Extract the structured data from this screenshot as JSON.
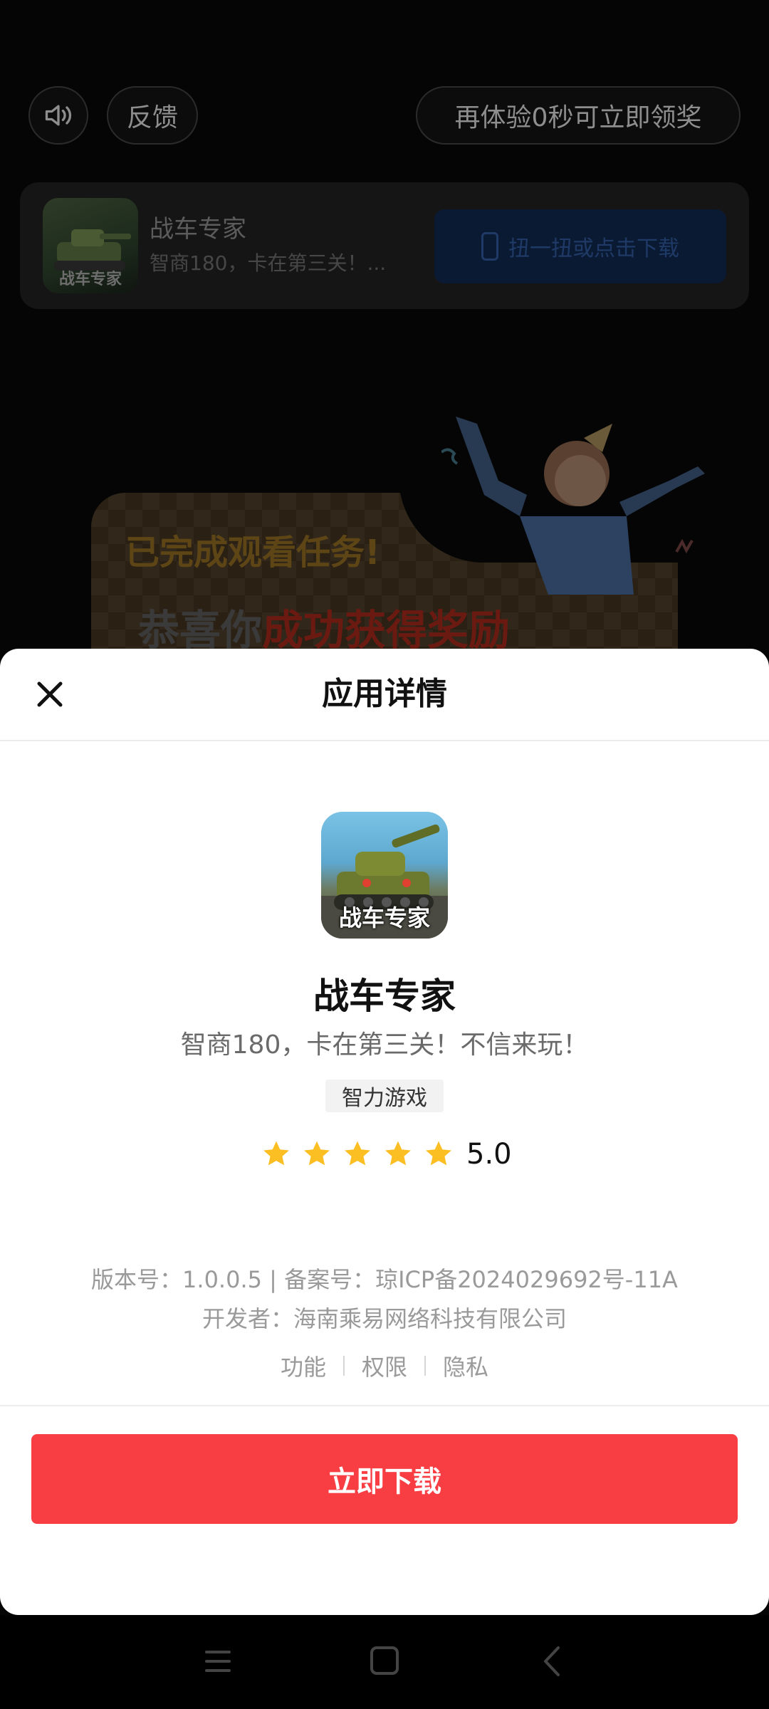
{
  "ad": {
    "feedback_label": "反馈",
    "reward_text": "再体验0秒可立即领奖",
    "card": {
      "icon_label": "战车专家",
      "title": "战车专家",
      "subtitle": "智商180，卡在第三关！...",
      "download_label": "扭一扭或点击下载"
    },
    "banner": {
      "task_text": "已完成观看任务!",
      "congrats_prefix": "恭喜你",
      "congrats_highlight": "成功获得奖励"
    }
  },
  "sheet": {
    "title": "应用详情",
    "app": {
      "icon_label": "战车专家",
      "name": "战车专家",
      "slogan": "智商180，卡在第三关！不信来玩！",
      "category": "智力游戏",
      "rating": 5.0,
      "rating_text": "5.0"
    },
    "meta": {
      "version_line": "版本号：1.0.0.5 | 备案号：琼ICP备2024029692号-11A",
      "developer_line": "开发者：海南乘易网络科技有限公司"
    },
    "links": [
      "功能",
      "权限",
      "隐私"
    ],
    "download_label": "立即下载"
  },
  "colors": {
    "accent": "#f83d43",
    "star": "#fbbf24"
  },
  "icons": [
    "speaker-icon",
    "close-icon",
    "star-icon",
    "menu-icon",
    "home-icon",
    "back-icon"
  ]
}
